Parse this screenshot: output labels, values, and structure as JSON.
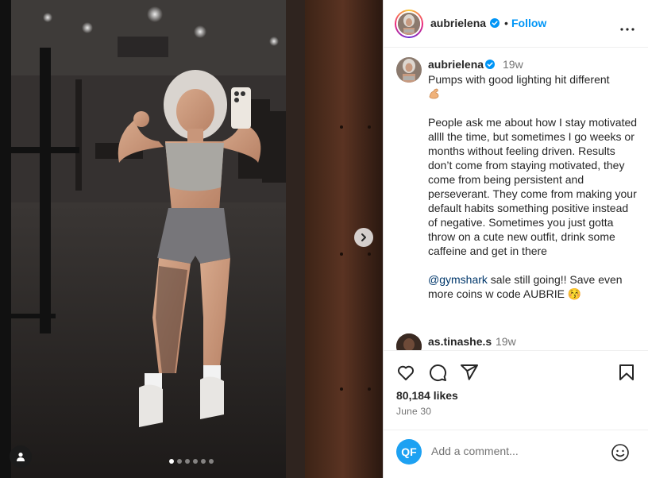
{
  "post": {
    "username": "aubrielena",
    "separator": "•",
    "follow_label": "Follow",
    "time_ago": "19w",
    "caption_line1": "Pumps with good lighting hit different",
    "caption_body": "People ask me about how I stay motivated allll the time, but sometimes I go weeks or months without feeling driven. Results don’t come from staying motivated, they come from being persistent and perseverant. They come from making your default habits something positive instead of negative. Sometimes you just gotta throw on a cute new outfit, drink some caffeine and get in there",
    "mention": "@gymshark",
    "caption_tail": " sale still going!! Save even more coins w code AUBRIE 😚",
    "likes": "80,184 likes",
    "date": "June 30"
  },
  "comments": [
    {
      "username": "as.tinashe.s",
      "time_ago": "19w"
    }
  ],
  "comment_box": {
    "avatar_initials": "QF",
    "placeholder": "Add a comment..."
  },
  "carousel": {
    "count": 6,
    "active_index": 0
  },
  "icons": {
    "header_more": "more-horizontal-icon",
    "verified": "verified-badge-icon",
    "like": "heart-icon",
    "comment": "comment-icon",
    "share": "share-icon",
    "save": "bookmark-icon",
    "next": "chevron-right-icon",
    "tagged": "user-tag-icon",
    "emoji": "emoji-icon"
  },
  "colors": {
    "accent": "#0095f6",
    "verified": "#0095f6",
    "mention": "#00376b",
    "muted": "#737373"
  }
}
